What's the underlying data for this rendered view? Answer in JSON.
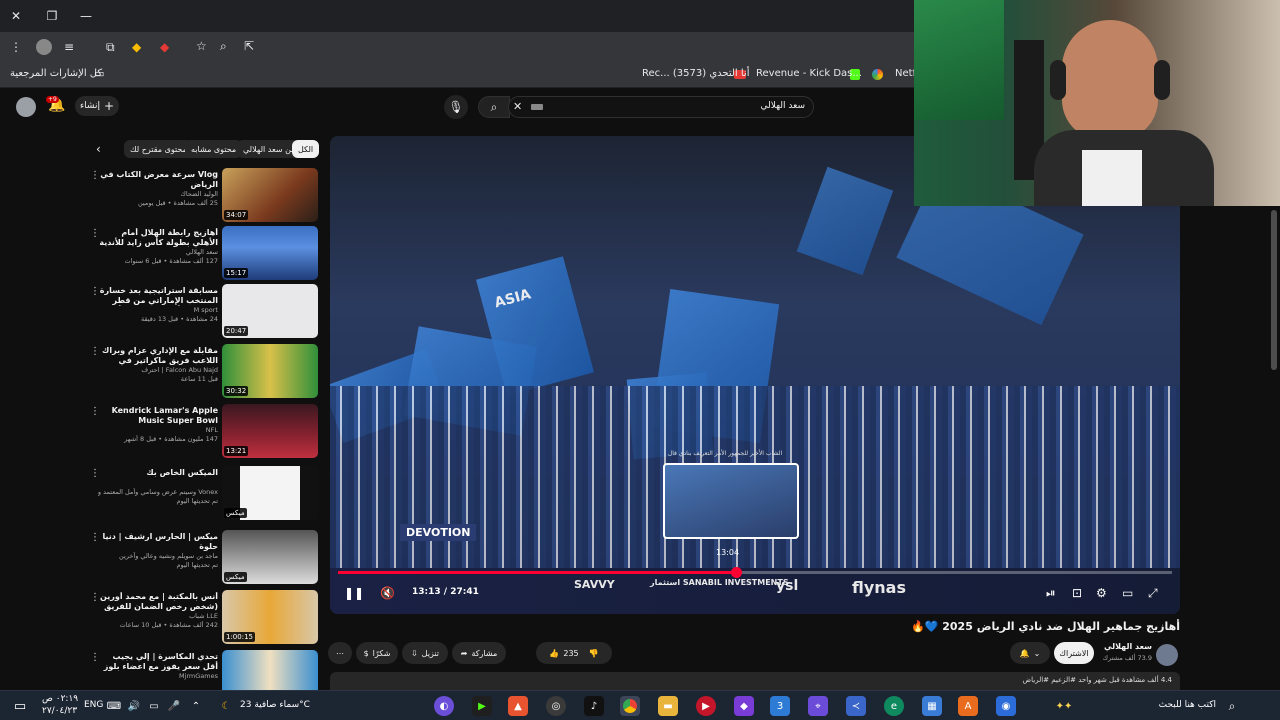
{
  "browser": {
    "bookmarks_label": "كل الإشارات المرجعية",
    "bookmarks": [
      {
        "label": "Rec... أنا التحدي (3573)"
      },
      {
        "label": "Revenue - Kick Das..."
      },
      {
        "label": "Netf"
      }
    ]
  },
  "header": {
    "create_label": "إنشاء",
    "notifications_count": "+9",
    "search_value": "سعد الهلالي"
  },
  "chips": {
    "all": "الكل",
    "from_channel": "من سعد الهلالي",
    "similar": "محتوى مشابه",
    "suggested": "محتوى مقترح لك"
  },
  "recommendations": [
    {
      "title": "Vlog سرعة معرض الكتاب في الرياض",
      "channel": "الوليد الضحاك",
      "meta": "25 ألف مشاهدة • قبل يومين",
      "duration": "34:07"
    },
    {
      "title": "أهازيج رابطة الهلال أمام الأهلي بطولة كأس زايد للأندية",
      "channel": "سعد الهلالي",
      "meta": "127 ألف مشاهدة • قبل 6 سنوات",
      "duration": "15:17"
    },
    {
      "title": "مسابقة استراتيجية بعد خسارة المنتخب الإماراتي من قطر وتعزيز التأهل المباشر لكأس العالم",
      "channel": "M sport",
      "meta": "24 مشاهدة • قبل 13 دقيقة",
      "duration": "20:47"
    },
    {
      "title": "مقابلة مع الإداري عزام وبراك اللاعب فريق ماكراتير في زيارات لبن | interview with...",
      "channel": "Falcon Abu Najd | احترف",
      "meta": "قبل 11 ساعة",
      "duration": "30:32"
    },
    {
      "title": "Kendrick Lamar's Apple Music Super Bowl Halftime Show",
      "channel": "NFL",
      "meta": "147 مليون مشاهدة • قبل 8 أشهر",
      "duration": "13:21"
    },
    {
      "title": "الميكس الخاص بك",
      "channel": "Vonex وسيتم عرض وسامي وأمل المعتمد وآخرين",
      "meta": "تم تحديثها اليوم",
      "duration": "ميكس"
    },
    {
      "title": "ميكس | الحارس ارشيف | دنيا حلوة",
      "channel": "ماجد بن سويلم ونشيه وعالي وآخرين",
      "meta": "تم تحديثها اليوم",
      "duration": "ميكس"
    },
    {
      "title": "أنس بالمكتبة | مع محمد أورين (شخص رخص الضمان للفريق 😂🔥)",
      "channel": "LLE شباب",
      "meta": "242 ألف مشاهدة • قبل 10 ساعات",
      "duration": "1:00:15"
    },
    {
      "title": "تحدي المكاسرة | إلي يجيب أقل سعر يفوز مع اعضاء بلوز 🔥",
      "channel": "MjrmGames",
      "meta": "",
      "duration": ""
    }
  ],
  "player": {
    "current_time": "13:13",
    "total_time": "27:41",
    "time_display": "13:13 / 27:41",
    "preview_time": "13:04",
    "preview_caption": "الشاب الأخير للجمهور الأمر التعريف بنادي فال",
    "progress": 0.477,
    "banner_logos": [
      "DEVOTION",
      "SAVVY",
      "استثمار SANABIL INVESTMENTS",
      "ysl",
      "flynas"
    ],
    "flag_text": "ASIA"
  },
  "video": {
    "title": "أهازيج جماهير الهلال ضد نادي الرياض 2025 💙🔥",
    "channel": "سعد الهلالي",
    "subscribers": "73.9 ألف مشترك",
    "subscribe_label": "الاشتراك",
    "likes": "235",
    "share_label": "مشاركة",
    "download_label": "تنزيل",
    "thanks_label": "شكرًا",
    "views_line": "4.4 ألف مشاهدة قبل شهر واحد #الزعيم #الرياض"
  },
  "taskbar": {
    "search_placeholder": "اكتب هنا للبحث",
    "weather": "سماء صافية 23°C",
    "language": "ENG",
    "time": "٠٢:١٩ ص",
    "date": "٢٧/٠٤/٢٣"
  },
  "colors": {
    "accent": "#ff0033",
    "hilal_blue": "#1d59a8"
  }
}
